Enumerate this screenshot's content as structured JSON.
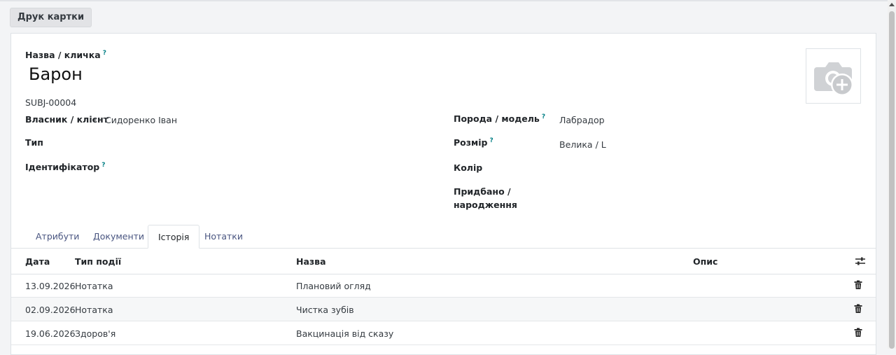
{
  "toolbar": {
    "print_label": "Друк картки"
  },
  "form": {
    "name_label": "Назва / кличка",
    "name_value": "Барон",
    "reference": "SUBJ-00004",
    "help_mark": "?",
    "owner_label": "Власник / клієнт",
    "owner_value": "Сидоренко Іван",
    "type_label": "Тип",
    "identifier_label": "Ідентифікатор",
    "breed_label": "Порода / модель",
    "breed_value": "Лабрадор",
    "size_label": "Розмір",
    "size_value": "Велика / L",
    "color_label": "Колір",
    "acquired_label_line1": "Придбано /",
    "acquired_label_line2": "народження"
  },
  "tabs": [
    {
      "label": "Атрибути",
      "active": false
    },
    {
      "label": "Документи",
      "active": false
    },
    {
      "label": "Історія",
      "active": true
    },
    {
      "label": "Нотатки",
      "active": false
    }
  ],
  "table": {
    "columns": [
      "Дата",
      "Тип події",
      "Назва",
      "Опис"
    ],
    "rows": [
      {
        "date": "13.09.2026",
        "type": "Нотатка",
        "name": "Плановий огляд",
        "description": ""
      },
      {
        "date": "02.09.2026",
        "type": "Нотатка",
        "name": "Чистка зубів",
        "description": ""
      },
      {
        "date": "19.06.2026",
        "type": "Здоров'я",
        "name": "Вакцинація від сказу",
        "description": ""
      }
    ]
  },
  "colors": {
    "accent": "#017e84",
    "tab_text": "#495580",
    "background": "#f3f4f6"
  },
  "icons": {
    "photo": "camera-plus-icon",
    "delete": "trash-icon",
    "optional_columns": "sliders-icon"
  }
}
